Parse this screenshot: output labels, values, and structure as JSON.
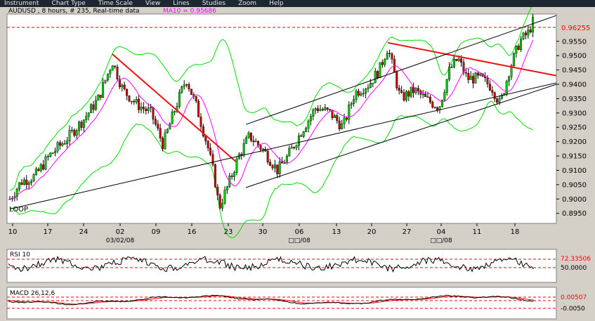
{
  "menu": {
    "items": [
      "Instrument",
      "Chart Type",
      "Time Scale",
      "View",
      "Lines",
      "Studies",
      "Zoom",
      "Help"
    ]
  },
  "header": {
    "symbol_info": "AUDUSD , 8 hours, # 235, Real-time data",
    "ma_label": "MA10 = 0.95686"
  },
  "price_labels": {
    "current": "0.96255",
    "ticks": [
      "0.9550",
      "0.9500",
      "0.9450",
      "0.9400",
      "0.9350",
      "0.9300",
      "0.9250",
      "0.9200",
      "0.9150",
      "0.9100",
      "0.9050",
      "0.9000",
      "0.8950"
    ]
  },
  "date_axis": {
    "days": [
      "10",
      "17",
      "24",
      "02",
      "09",
      "16",
      "23",
      "30",
      "06",
      "13",
      "20",
      "27",
      "04",
      "11",
      "18"
    ],
    "months": [
      "03/02/08",
      "□□/08",
      "□□/08"
    ]
  },
  "corner_text": "LOOP",
  "rsi": {
    "label": "RSI 10",
    "value": "72.33506",
    "level": "50.0000"
  },
  "macd": {
    "label": "MACD 26,12,6",
    "value": "0.00507",
    "level": "-0.0050"
  },
  "colors": {
    "bull": "#00cc00",
    "bear": "#cc0000",
    "ma": "#ff00ff",
    "bands": "#00dd00",
    "trendline": "#ee1111",
    "channel": "#000000",
    "dashed_level": "#ff0000",
    "frame": "#d4d0c8"
  },
  "chart_data": {
    "type": "candlestick",
    "title": "AUDUSD , 8 hours, # 235, Real-time data",
    "ylim": [
      0.8915,
      0.9645
    ],
    "y_ticks": [
      0.955,
      0.95,
      0.945,
      0.94,
      0.935,
      0.93,
      0.925,
      0.92,
      0.915,
      0.91,
      0.905,
      0.9,
      0.895
    ],
    "current_price": 0.96255,
    "series_ohlc_approx": [
      {
        "date": "10",
        "open": 0.901,
        "high": 0.904,
        "low": 0.896,
        "close": 0.903
      },
      {
        "date": "17",
        "open": 0.91,
        "high": 0.918,
        "low": 0.906,
        "close": 0.916
      },
      {
        "date": "24",
        "open": 0.925,
        "high": 0.933,
        "low": 0.922,
        "close": 0.931
      },
      {
        "date": "02",
        "open": 0.948,
        "high": 0.95,
        "low": 0.933,
        "close": 0.936
      },
      {
        "date": "09",
        "open": 0.933,
        "high": 0.937,
        "low": 0.918,
        "close": 0.92
      },
      {
        "date": "16",
        "open": 0.939,
        "high": 0.945,
        "low": 0.93,
        "close": 0.942
      },
      {
        "date": "23",
        "open": 0.904,
        "high": 0.908,
        "low": 0.895,
        "close": 0.899
      },
      {
        "date": "30",
        "open": 0.918,
        "high": 0.922,
        "low": 0.91,
        "close": 0.912
      },
      {
        "date": "06",
        "open": 0.925,
        "high": 0.931,
        "low": 0.922,
        "close": 0.93
      },
      {
        "date": "13",
        "open": 0.928,
        "high": 0.934,
        "low": 0.925,
        "close": 0.927
      },
      {
        "date": "20",
        "open": 0.94,
        "high": 0.953,
        "low": 0.938,
        "close": 0.95
      },
      {
        "date": "27",
        "open": 0.935,
        "high": 0.94,
        "low": 0.929,
        "close": 0.933
      },
      {
        "date": "04",
        "open": 0.942,
        "high": 0.951,
        "low": 0.94,
        "close": 0.948
      },
      {
        "date": "11",
        "open": 0.943,
        "high": 0.947,
        "low": 0.934,
        "close": 0.936
      },
      {
        "date": "18",
        "open": 0.952,
        "high": 0.964,
        "low": 0.95,
        "close": 0.9625
      }
    ],
    "indicators": [
      "MA10 = 0.95686",
      "RSI 10",
      "MACD 26,12,6"
    ],
    "grid": false,
    "legend": "top-left"
  }
}
